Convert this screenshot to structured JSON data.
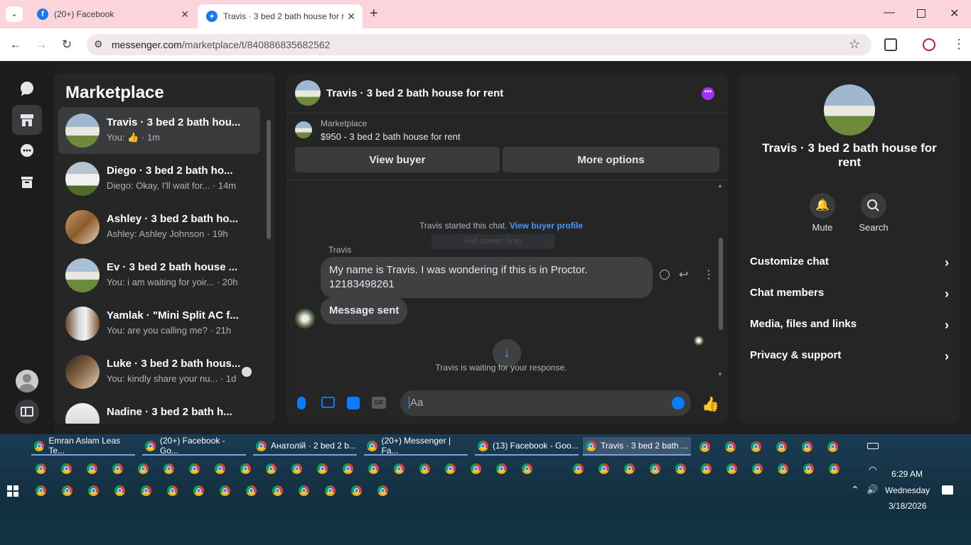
{
  "browser": {
    "tabs": [
      {
        "title": "(20+) Facebook",
        "icon": "facebook-icon"
      },
      {
        "title": "Travis · 3 bed 2 bath house for r",
        "icon": "messenger-icon"
      }
    ],
    "url_domain": "messenger.com",
    "url_path": "/marketplace/t/840886835682562"
  },
  "sidebar_list": {
    "title": "Marketplace",
    "conversations": [
      {
        "title": "Travis · 3 bed 2 bath hou...",
        "snippet_prefix": "You:",
        "snippet": "· 1m",
        "selected": true
      },
      {
        "title": "Diego · 3 bed 2 bath ho...",
        "snippet": "Diego: Okay, I'll wait for... · 14m"
      },
      {
        "title": "Ashley · 3 bed 2 bath ho...",
        "snippet": "Ashley: Ashley Johnson · 19h"
      },
      {
        "title": "Ev · 3 bed 2 bath house ...",
        "snippet": "You: i am waiting for yoir... · 20h"
      },
      {
        "title": "Yamlak · \"Mini Split AC f...",
        "snippet": "You: are you calling me? · 21h"
      },
      {
        "title": "Luke · 3 bed 2 bath hous...",
        "snippet": "You: kindly share your nu... · 1d"
      },
      {
        "title": "Nadine · 3 bed 2 bath h...",
        "snippet": ""
      }
    ]
  },
  "chat": {
    "header_title": "Travis · 3 bed 2 bath house for rent",
    "listing_label": "Marketplace",
    "listing_title": "$950 - 3 bed 2 bath house for rent",
    "view_buyer": "View buyer",
    "more_options": "More options",
    "started_text": "Travis started this chat.",
    "view_buyer_profile": "View buyer profile",
    "snip_overlay": "Full-screen Snip",
    "sender_name": "Travis",
    "message_1": "My name is Travis. I was wondering if this is in Proctor. 12183498261",
    "message_2": "Message sent",
    "waiting_text": "Travis is waiting for your response.",
    "composer_placeholder": "Aa"
  },
  "details": {
    "title": "Travis · 3 bed 2 bath house for rent",
    "mute_label": "Mute",
    "search_label": "Search",
    "rows": [
      "Customize chat",
      "Chat members",
      "Media, files and links",
      "Privacy & support"
    ]
  },
  "taskbar": {
    "tasks": [
      "Emran Aslam Leas Te...",
      "(20+) Facebook - Go...",
      "Анатолій · 2 bed 2 b...",
      "(20+) Messenger | Fa...",
      "(13) Facebook - Goo...",
      "Travis · 3 bed 2 bath ..."
    ],
    "time": "6:29 AM",
    "day": "Wednesday",
    "date": "3/18/2026"
  },
  "colors": {
    "accent": "#0a7cff",
    "messenger_purple": "#a033ff",
    "tabbar_bg": "#fbd5db"
  }
}
